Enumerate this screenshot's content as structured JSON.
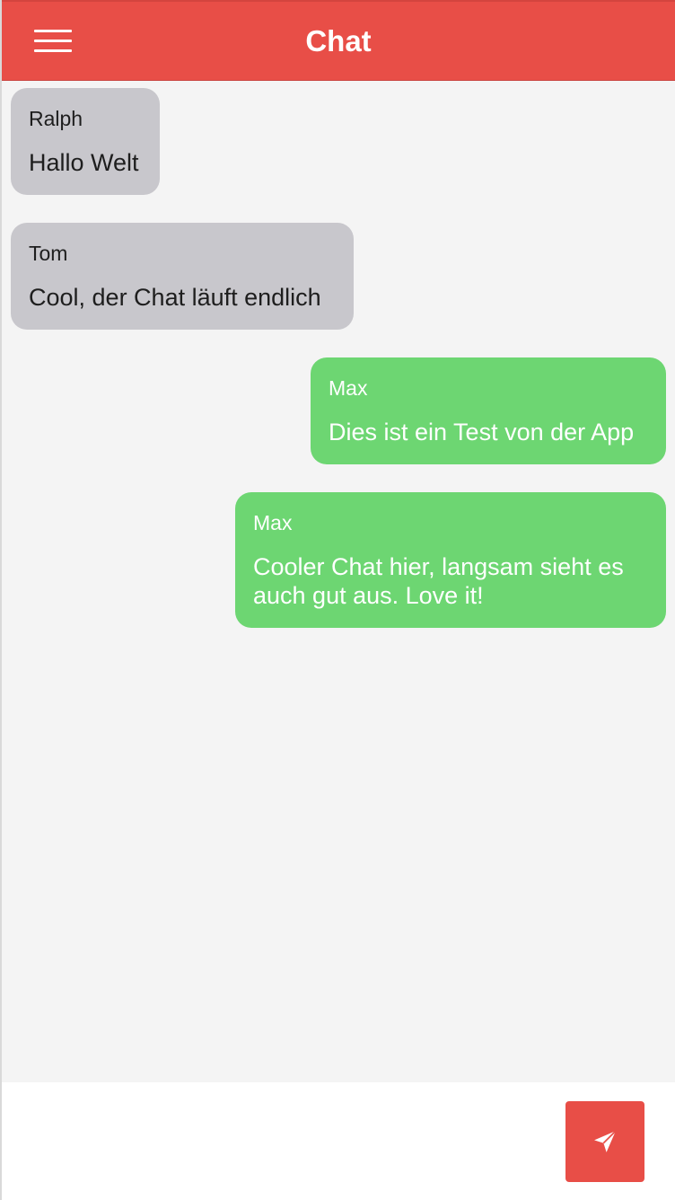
{
  "header": {
    "title": "Chat",
    "menu_icon": "hamburger-menu-icon"
  },
  "messages": [
    {
      "sender": "Ralph",
      "text": "Hallo Welt",
      "direction": "incoming"
    },
    {
      "sender": "Tom",
      "text": "Cool, der Chat läuft endlich",
      "direction": "incoming"
    },
    {
      "sender": "Max",
      "text": "Dies ist ein Test von der App",
      "direction": "outgoing"
    },
    {
      "sender": "Max",
      "text": "Cooler Chat hier, langsam sieht es auch gut aus. Love it!",
      "direction": "outgoing"
    }
  ],
  "composer": {
    "value": "",
    "placeholder": "",
    "send_icon": "send-paper-plane-icon"
  },
  "colors": {
    "accent": "#e84e47",
    "incoming_bubble": "#c8c7cc",
    "outgoing_bubble": "#6dd672",
    "background": "#f4f4f4"
  }
}
